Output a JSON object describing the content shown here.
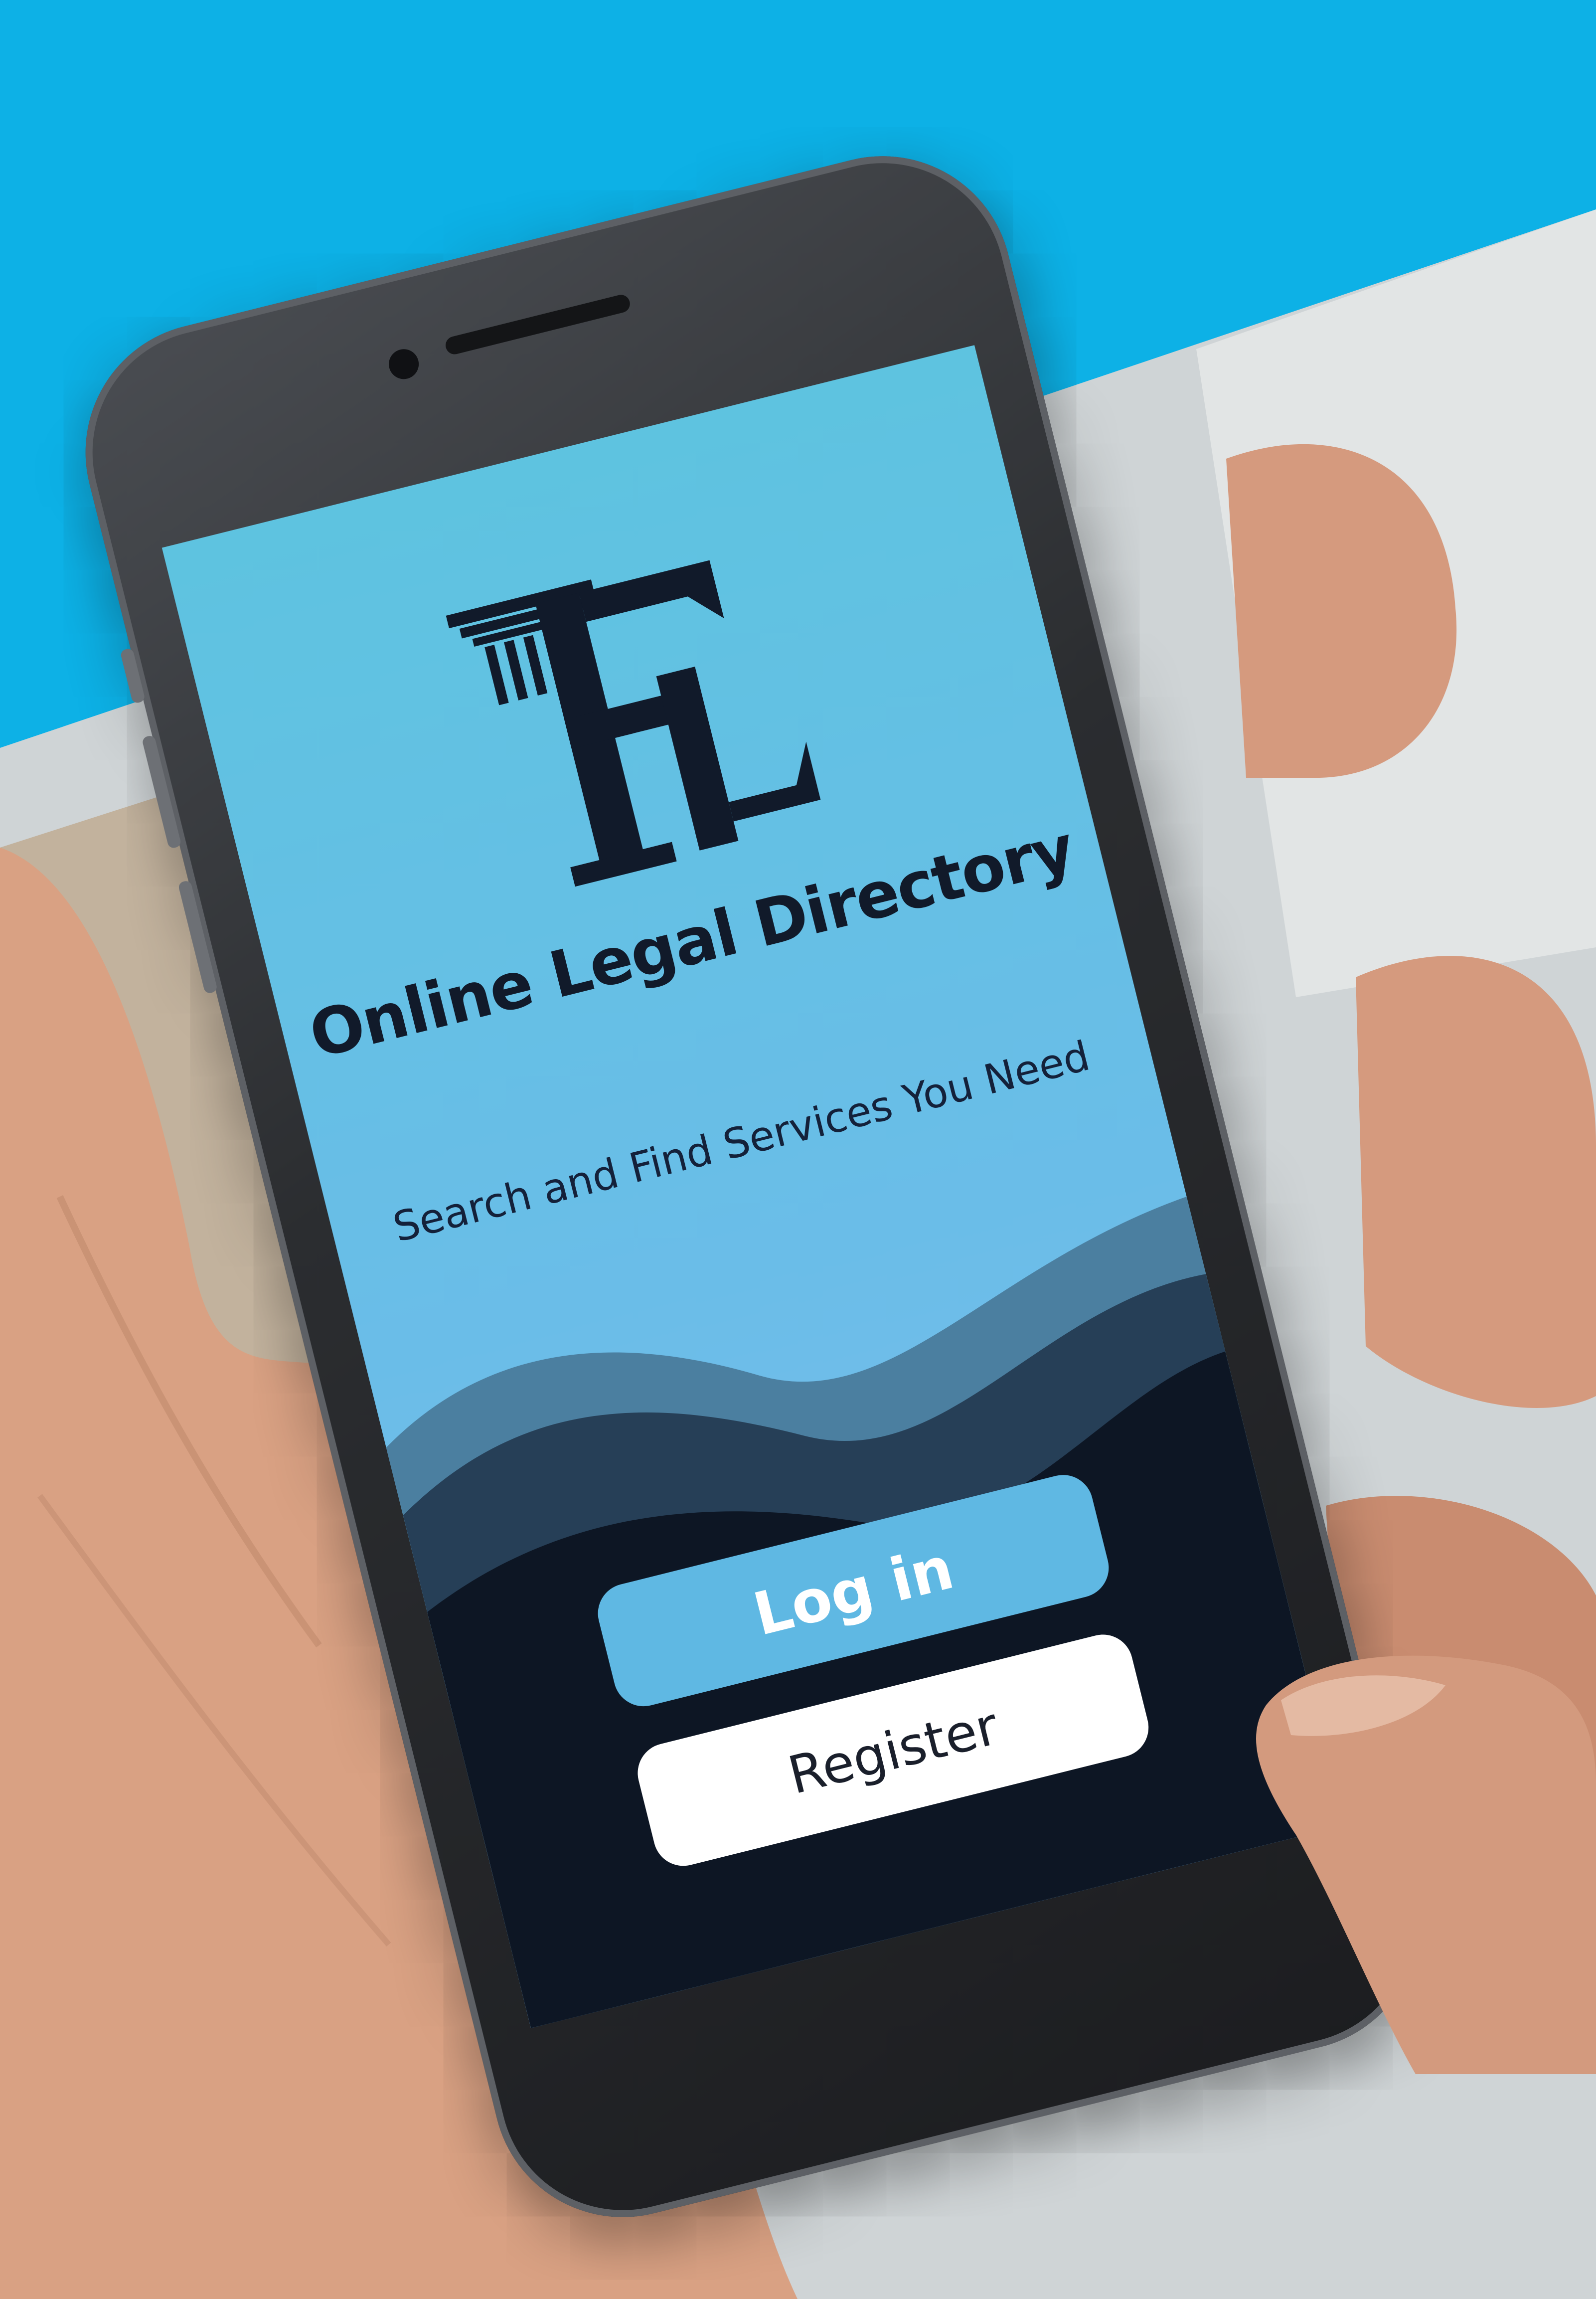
{
  "app": {
    "title": "Online Legal Directory",
    "tagline": "Search and Find Services You Need",
    "logo_monogram": "FL"
  },
  "actions": {
    "login_label": "Log in",
    "register_label": "Register"
  },
  "colors": {
    "background_top": "#0db1e6",
    "screen_gradient_top": "#5ec3e0",
    "screen_gradient_bottom": "#7fbdee",
    "dark_navy": "#0d1624",
    "wave_mid": "#4b7fa0",
    "wave_dark": "#263f57",
    "login_button": "#5fb8e3",
    "register_button": "#ffffff",
    "title_text": "#111a2a"
  },
  "icons": {
    "logo": "column-monogram-logo"
  }
}
